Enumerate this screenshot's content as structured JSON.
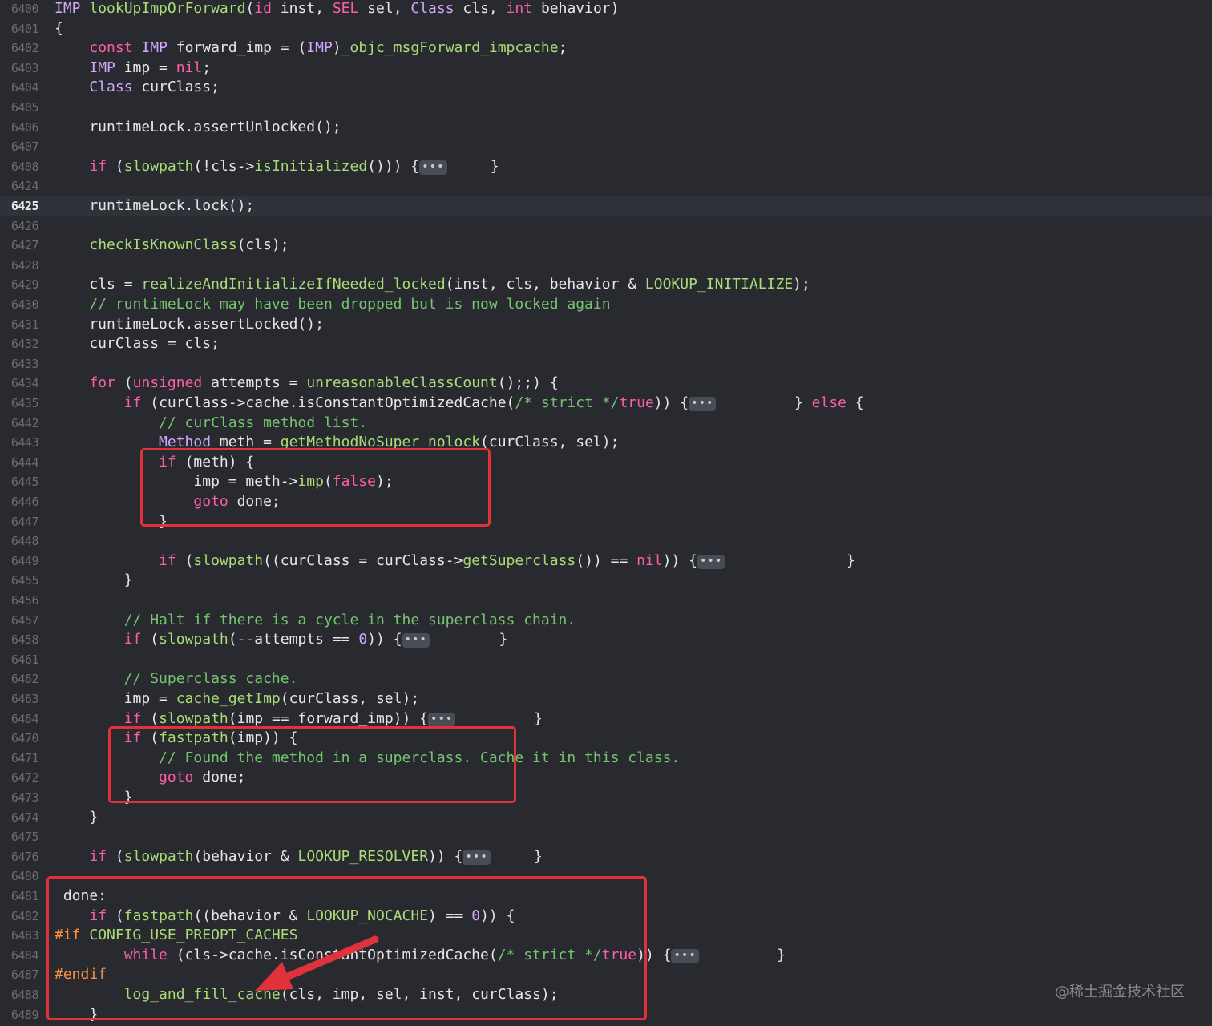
{
  "editor": {
    "current_line": "6425",
    "lines": [
      {
        "num": "6400",
        "tokens": [
          [
            "type",
            "IMP"
          ],
          [
            "plain",
            " "
          ],
          [
            "fn",
            "lookUpImpOrForward"
          ],
          [
            "plain",
            "("
          ],
          [
            "kw",
            "id"
          ],
          [
            "plain",
            " inst, "
          ],
          [
            "kw",
            "SEL"
          ],
          [
            "plain",
            " sel, "
          ],
          [
            "type",
            "Class"
          ],
          [
            "plain",
            " cls, "
          ],
          [
            "kw",
            "int"
          ],
          [
            "plain",
            " behavior)"
          ]
        ]
      },
      {
        "num": "6401",
        "tokens": [
          [
            "plain",
            "{"
          ]
        ]
      },
      {
        "num": "6402",
        "tokens": [
          [
            "plain",
            "    "
          ],
          [
            "kw",
            "const"
          ],
          [
            "plain",
            " "
          ],
          [
            "type",
            "IMP"
          ],
          [
            "plain",
            " forward_imp = ("
          ],
          [
            "type",
            "IMP"
          ],
          [
            "plain",
            ")"
          ],
          [
            "fn",
            "_objc_msgForward_impcache"
          ],
          [
            "plain",
            ";"
          ]
        ]
      },
      {
        "num": "6403",
        "tokens": [
          [
            "plain",
            "    "
          ],
          [
            "type",
            "IMP"
          ],
          [
            "plain",
            " imp = "
          ],
          [
            "kw",
            "nil"
          ],
          [
            "plain",
            ";"
          ]
        ]
      },
      {
        "num": "6404",
        "tokens": [
          [
            "plain",
            "    "
          ],
          [
            "type",
            "Class"
          ],
          [
            "plain",
            " curClass;"
          ]
        ]
      },
      {
        "num": "6405",
        "tokens": []
      },
      {
        "num": "6406",
        "tokens": [
          [
            "plain",
            "    runtimeLock.assertUnlocked();"
          ]
        ]
      },
      {
        "num": "6407",
        "tokens": []
      },
      {
        "num": "6408",
        "tokens": [
          [
            "plain",
            "    "
          ],
          [
            "kw",
            "if"
          ],
          [
            "plain",
            " ("
          ],
          [
            "fn",
            "slowpath"
          ],
          [
            "plain",
            "(!cls->"
          ],
          [
            "fn",
            "isInitialized"
          ],
          [
            "plain",
            "())) {"
          ],
          [
            "fold",
            "•••"
          ],
          [
            "plain",
            "     }"
          ]
        ]
      },
      {
        "num": "6424",
        "tokens": []
      },
      {
        "num": "6425",
        "tokens": [
          [
            "plain",
            "    runtimeLock.lock();"
          ]
        ]
      },
      {
        "num": "6426",
        "tokens": []
      },
      {
        "num": "6427",
        "tokens": [
          [
            "plain",
            "    "
          ],
          [
            "fn",
            "checkIsKnownClass"
          ],
          [
            "plain",
            "(cls);"
          ]
        ]
      },
      {
        "num": "6428",
        "tokens": []
      },
      {
        "num": "6429",
        "tokens": [
          [
            "plain",
            "    cls = "
          ],
          [
            "fn",
            "realizeAndInitializeIfNeeded_locked"
          ],
          [
            "plain",
            "(inst, cls, behavior & "
          ],
          [
            "fn",
            "LOOKUP_INITIALIZE"
          ],
          [
            "plain",
            ");"
          ]
        ]
      },
      {
        "num": "6430",
        "tokens": [
          [
            "cm",
            "    // runtimeLock may have been dropped but is now locked again"
          ]
        ]
      },
      {
        "num": "6431",
        "tokens": [
          [
            "plain",
            "    runtimeLock.assertLocked();"
          ]
        ]
      },
      {
        "num": "6432",
        "tokens": [
          [
            "plain",
            "    curClass = cls;"
          ]
        ]
      },
      {
        "num": "6433",
        "tokens": []
      },
      {
        "num": "6434",
        "tokens": [
          [
            "plain",
            "    "
          ],
          [
            "kw",
            "for"
          ],
          [
            "plain",
            " ("
          ],
          [
            "kw",
            "unsigned"
          ],
          [
            "plain",
            " attempts = "
          ],
          [
            "fn",
            "unreasonableClassCount"
          ],
          [
            "plain",
            "();;) {"
          ]
        ]
      },
      {
        "num": "6435",
        "tokens": [
          [
            "plain",
            "        "
          ],
          [
            "kw",
            "if"
          ],
          [
            "plain",
            " (curClass->cache.isConstantOptimizedCache("
          ],
          [
            "cm",
            "/* strict */"
          ],
          [
            "kw",
            "true"
          ],
          [
            "plain",
            ")) {"
          ],
          [
            "fold",
            "•••"
          ],
          [
            "plain",
            "         } "
          ],
          [
            "kw",
            "else"
          ],
          [
            "plain",
            " {"
          ]
        ]
      },
      {
        "num": "6442",
        "tokens": [
          [
            "cm",
            "            // curClass method list."
          ]
        ]
      },
      {
        "num": "6443",
        "tokens": [
          [
            "plain",
            "            "
          ],
          [
            "type",
            "Method"
          ],
          [
            "plain",
            " meth = "
          ],
          [
            "fn",
            "getMethodNoSuper_nolock"
          ],
          [
            "plain",
            "(curClass, sel);"
          ]
        ]
      },
      {
        "num": "6444",
        "tokens": [
          [
            "plain",
            "            "
          ],
          [
            "kw",
            "if"
          ],
          [
            "plain",
            " (meth) {"
          ]
        ]
      },
      {
        "num": "6445",
        "tokens": [
          [
            "plain",
            "                imp = meth->"
          ],
          [
            "fn",
            "imp"
          ],
          [
            "plain",
            "("
          ],
          [
            "kw",
            "false"
          ],
          [
            "plain",
            ");"
          ]
        ]
      },
      {
        "num": "6446",
        "tokens": [
          [
            "plain",
            "                "
          ],
          [
            "kw",
            "goto"
          ],
          [
            "plain",
            " done;"
          ]
        ]
      },
      {
        "num": "6447",
        "tokens": [
          [
            "plain",
            "            }"
          ]
        ]
      },
      {
        "num": "6448",
        "tokens": []
      },
      {
        "num": "6449",
        "tokens": [
          [
            "plain",
            "            "
          ],
          [
            "kw",
            "if"
          ],
          [
            "plain",
            " ("
          ],
          [
            "fn",
            "slowpath"
          ],
          [
            "plain",
            "((curClass = curClass->"
          ],
          [
            "fn",
            "getSuperclass"
          ],
          [
            "plain",
            "()) == "
          ],
          [
            "kw",
            "nil"
          ],
          [
            "plain",
            ")) {"
          ],
          [
            "fold",
            "•••"
          ],
          [
            "plain",
            "              }"
          ]
        ]
      },
      {
        "num": "6455",
        "tokens": [
          [
            "plain",
            "        }"
          ]
        ]
      },
      {
        "num": "6456",
        "tokens": []
      },
      {
        "num": "6457",
        "tokens": [
          [
            "cm",
            "        // Halt if there is a cycle in the superclass chain."
          ]
        ]
      },
      {
        "num": "6458",
        "tokens": [
          [
            "plain",
            "        "
          ],
          [
            "kw",
            "if"
          ],
          [
            "plain",
            " ("
          ],
          [
            "fn",
            "slowpath"
          ],
          [
            "plain",
            "(--attempts == "
          ],
          [
            "type",
            "0"
          ],
          [
            "plain",
            ")) {"
          ],
          [
            "fold",
            "•••"
          ],
          [
            "plain",
            "        }"
          ]
        ]
      },
      {
        "num": "6461",
        "tokens": []
      },
      {
        "num": "6462",
        "tokens": [
          [
            "cm",
            "        // Superclass cache."
          ]
        ]
      },
      {
        "num": "6463",
        "tokens": [
          [
            "plain",
            "        imp = "
          ],
          [
            "fn",
            "cache_getImp"
          ],
          [
            "plain",
            "(curClass, sel);"
          ]
        ]
      },
      {
        "num": "6464",
        "tokens": [
          [
            "plain",
            "        "
          ],
          [
            "kw",
            "if"
          ],
          [
            "plain",
            " ("
          ],
          [
            "fn",
            "slowpath"
          ],
          [
            "plain",
            "(imp == forward_imp)) {"
          ],
          [
            "fold",
            "•••"
          ],
          [
            "plain",
            "         }"
          ]
        ]
      },
      {
        "num": "6470",
        "tokens": [
          [
            "plain",
            "        "
          ],
          [
            "kw",
            "if"
          ],
          [
            "plain",
            " ("
          ],
          [
            "fn",
            "fastpath"
          ],
          [
            "plain",
            "(imp)) {"
          ]
        ]
      },
      {
        "num": "6471",
        "tokens": [
          [
            "cm",
            "            // Found the method in a superclass. Cache it in this class."
          ]
        ]
      },
      {
        "num": "6472",
        "tokens": [
          [
            "plain",
            "            "
          ],
          [
            "kw",
            "goto"
          ],
          [
            "plain",
            " done;"
          ]
        ]
      },
      {
        "num": "6473",
        "tokens": [
          [
            "plain",
            "        }"
          ]
        ]
      },
      {
        "num": "6474",
        "tokens": [
          [
            "plain",
            "    }"
          ]
        ]
      },
      {
        "num": "6475",
        "tokens": []
      },
      {
        "num": "6476",
        "tokens": [
          [
            "plain",
            "    "
          ],
          [
            "kw",
            "if"
          ],
          [
            "plain",
            " ("
          ],
          [
            "fn",
            "slowpath"
          ],
          [
            "plain",
            "(behavior & "
          ],
          [
            "fn",
            "LOOKUP_RESOLVER"
          ],
          [
            "plain",
            ")) {"
          ],
          [
            "fold",
            "•••"
          ],
          [
            "plain",
            "     }"
          ]
        ]
      },
      {
        "num": "6480",
        "tokens": []
      },
      {
        "num": "6481",
        "tokens": [
          [
            "plain",
            " done:"
          ]
        ]
      },
      {
        "num": "6482",
        "tokens": [
          [
            "plain",
            "    "
          ],
          [
            "kw",
            "if"
          ],
          [
            "plain",
            " ("
          ],
          [
            "fn",
            "fastpath"
          ],
          [
            "plain",
            "((behavior & "
          ],
          [
            "fn",
            "LOOKUP_NOCACHE"
          ],
          [
            "plain",
            ") == "
          ],
          [
            "type",
            "0"
          ],
          [
            "plain",
            ")) {"
          ]
        ]
      },
      {
        "num": "6483",
        "tokens": [
          [
            "mac",
            "#if"
          ],
          [
            "plain",
            " "
          ],
          [
            "fn",
            "CONFIG_USE_PREOPT_CACHES"
          ]
        ]
      },
      {
        "num": "6484",
        "tokens": [
          [
            "plain",
            "        "
          ],
          [
            "kw",
            "while"
          ],
          [
            "plain",
            " (cls->cache.isConstantOptimizedCache("
          ],
          [
            "cm",
            "/* strict */"
          ],
          [
            "kw",
            "true"
          ],
          [
            "plain",
            ")) {"
          ],
          [
            "fold",
            "•••"
          ],
          [
            "plain",
            "         }"
          ]
        ]
      },
      {
        "num": "6487",
        "tokens": [
          [
            "mac",
            "#endif"
          ]
        ]
      },
      {
        "num": "6488",
        "tokens": [
          [
            "plain",
            "        "
          ],
          [
            "fn",
            "log_and_fill_cache"
          ],
          [
            "plain",
            "(cls, imp, sel, inst, curClass);"
          ]
        ]
      },
      {
        "num": "6489",
        "tokens": [
          [
            "plain",
            "    }"
          ]
        ]
      }
    ]
  },
  "watermark": "@稀土掘金技术社区",
  "colors": {
    "background": "#292a30",
    "keyword": "#fc5fa3",
    "comment": "#75c56e",
    "function": "#a9dc76",
    "highlight_box": "#e0323a"
  }
}
